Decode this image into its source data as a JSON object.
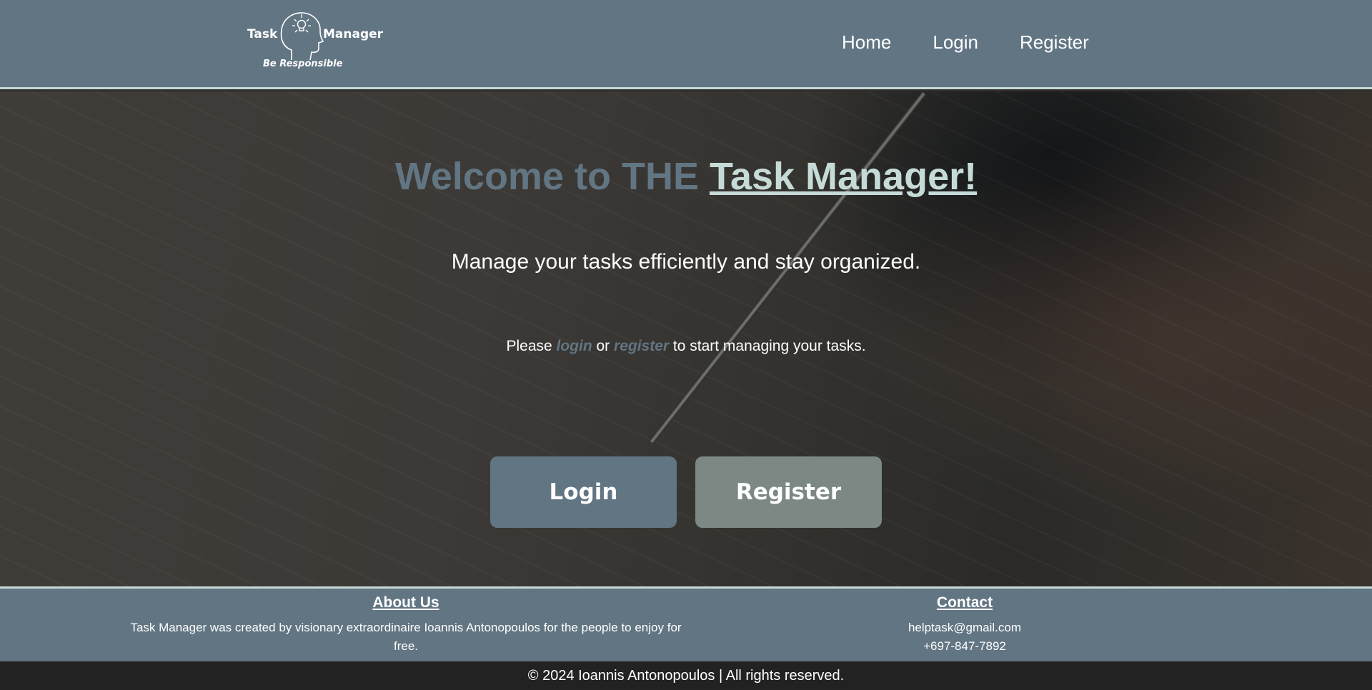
{
  "header": {
    "logo": {
      "word_left": "Task",
      "word_right": "Manager",
      "tagline": "Be Responsible"
    },
    "nav": [
      {
        "label": "Home"
      },
      {
        "label": "Login"
      },
      {
        "label": "Register"
      }
    ]
  },
  "hero": {
    "title_prefix": "Welcome to THE ",
    "title_brand": "Task Manager!",
    "subtitle": "Manage your tasks efficiently and stay organized.",
    "note": {
      "before": "Please ",
      "login_link": "login",
      "middle": " or ",
      "register_link": "register",
      "after": " to start managing your tasks."
    },
    "buttons": {
      "login": "Login",
      "register": "Register"
    }
  },
  "footer": {
    "about": {
      "heading": "About Us",
      "text": "Task Manager was created by visionary extraordinaire Ioannis Antonopoulos for the people to enjoy for free."
    },
    "contact": {
      "heading": "Contact",
      "email": "helptask@gmail.com",
      "phone": "+697-847-7892"
    },
    "copyright": "© 2024 Ioannis Antonopoulos | All rights reserved."
  },
  "colors": {
    "primary": "#627583",
    "accent": "#c6dbd7",
    "secondary_button": "#7b8884",
    "copyright_bar": "#222222"
  }
}
